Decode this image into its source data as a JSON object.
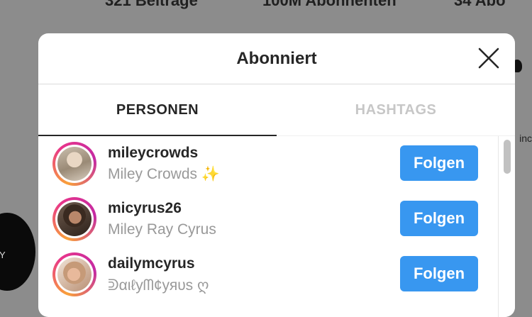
{
  "background": {
    "stats": [
      {
        "text": "321 Beiträge"
      },
      {
        "text": "100M Abonnenten"
      },
      {
        "text": "34 Abo"
      }
    ],
    "story_letter": "Y",
    "side_text": "inc"
  },
  "modal": {
    "title": "Abonniert",
    "close_icon": "close-icon",
    "tabs": [
      {
        "label": "PERSONEN",
        "active": true
      },
      {
        "label": "HASHTAGS",
        "active": false
      }
    ],
    "accounts": [
      {
        "username": "mileycrowds",
        "full_name": "Miley Crowds ✨",
        "button": "Folgen"
      },
      {
        "username": "micyrus26",
        "full_name": "Miley Ray Cyrus",
        "button": "Folgen"
      },
      {
        "username": "dailymcyrus",
        "full_name": "ᕲαιℓуᗰ¢уяυѕ ღ",
        "button": "Folgen"
      }
    ]
  },
  "colors": {
    "accent": "#3897f0",
    "overlay": "#8c8c8c",
    "story_ring_start": "#f9a13a",
    "story_ring_end": "#c32aa3"
  }
}
